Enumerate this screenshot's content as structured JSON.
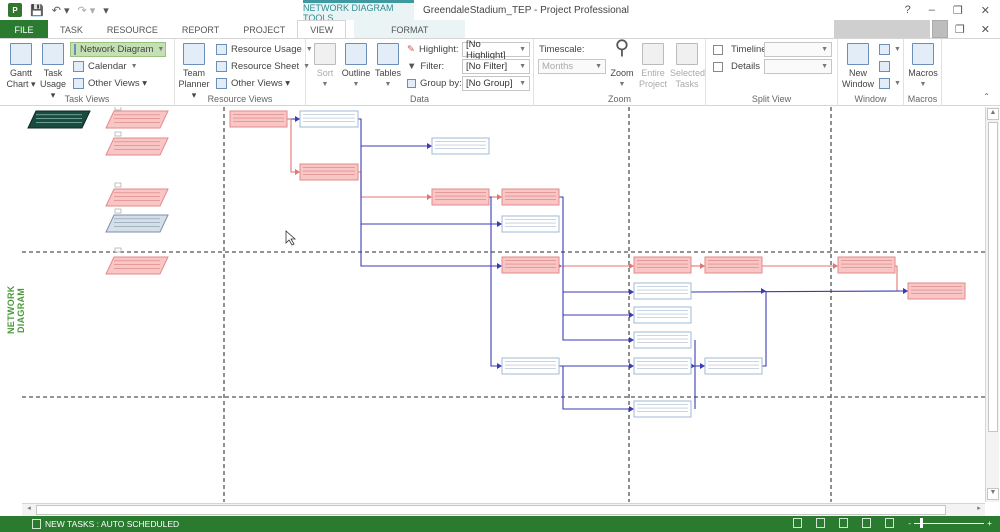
{
  "window": {
    "title": "GreendaleStadium_TEP - Project Professional",
    "context_tab_header": "NETWORK DIAGRAM TOOLS",
    "controls": {
      "help": "?",
      "minimize": "–",
      "restore": "❐",
      "close": "✕"
    },
    "doc_controls": {
      "restore": "❐",
      "close": "✕"
    }
  },
  "quick_access": {
    "app_icon": "P",
    "save": "save-icon",
    "undo": "↶ ▾",
    "redo": "↷ ▾",
    "customize": "⩡"
  },
  "tabs": [
    {
      "label": "FILE"
    },
    {
      "label": "TASK"
    },
    {
      "label": "RESOURCE"
    },
    {
      "label": "REPORT"
    },
    {
      "label": "PROJECT"
    },
    {
      "label": "VIEW",
      "active": true
    },
    {
      "label": "FORMAT"
    }
  ],
  "ribbon": {
    "task_views": {
      "label": "Task Views",
      "gantt_chart": "Gantt\nChart ▾",
      "gantt_chart_l1": "Gantt",
      "gantt_chart_l2": "Chart ▾",
      "task_usage_l1": "Task",
      "task_usage_l2": "Usage ▾",
      "network_diagram": "Network Diagram",
      "calendar": "Calendar",
      "other_views": "Other Views ▾"
    },
    "resource_views": {
      "label": "Resource Views",
      "team_planner_l1": "Team",
      "team_planner_l2": "Planner ▾",
      "resource_usage": "Resource Usage",
      "resource_sheet": "Resource Sheet",
      "other_views": "Other Views ▾"
    },
    "data": {
      "label": "Data",
      "sort": "Sort",
      "outline": "Outline",
      "tables": "Tables",
      "highlight_label": "Highlight:",
      "highlight_value": "[No Highlight]",
      "filter_label": "Filter:",
      "filter_value": "[No Filter]",
      "group_label": "Group by:",
      "group_value": "[No Group]"
    },
    "zoom": {
      "label": "Zoom",
      "timescale_label": "Timescale:",
      "timescale_value": "Months",
      "zoom": "Zoom",
      "entire_project_l1": "Entire",
      "entire_project_l2": "Project",
      "selected_tasks_l1": "Selected",
      "selected_tasks_l2": "Tasks"
    },
    "split_view": {
      "label": "Split View",
      "timeline": "Timeline",
      "timeline_checked": false,
      "details": "Details",
      "details_checked": false
    },
    "window": {
      "label": "Window",
      "new_window_l1": "New",
      "new_window_l2": "Window"
    },
    "macros": {
      "label": "Macros",
      "macros": "Macros"
    }
  },
  "view": {
    "side_label": "NETWORK DIAGRAM",
    "colors": {
      "critical_fill": "#f9c6c6",
      "critical_border": "#e38a8a",
      "critical_link": "#e57373",
      "normal_fill": "#ffffff",
      "normal_border": "#9fb8d6",
      "normal_link": "#3b3bb3",
      "summary_fill": "#1a4a40",
      "milestone_fill": "#d5dfea",
      "page_break": "#555555"
    }
  },
  "statusbar": {
    "new_tasks": "NEW TASKS : AUTO SCHEDULED",
    "zoom_out": "-",
    "zoom_in": "+"
  }
}
